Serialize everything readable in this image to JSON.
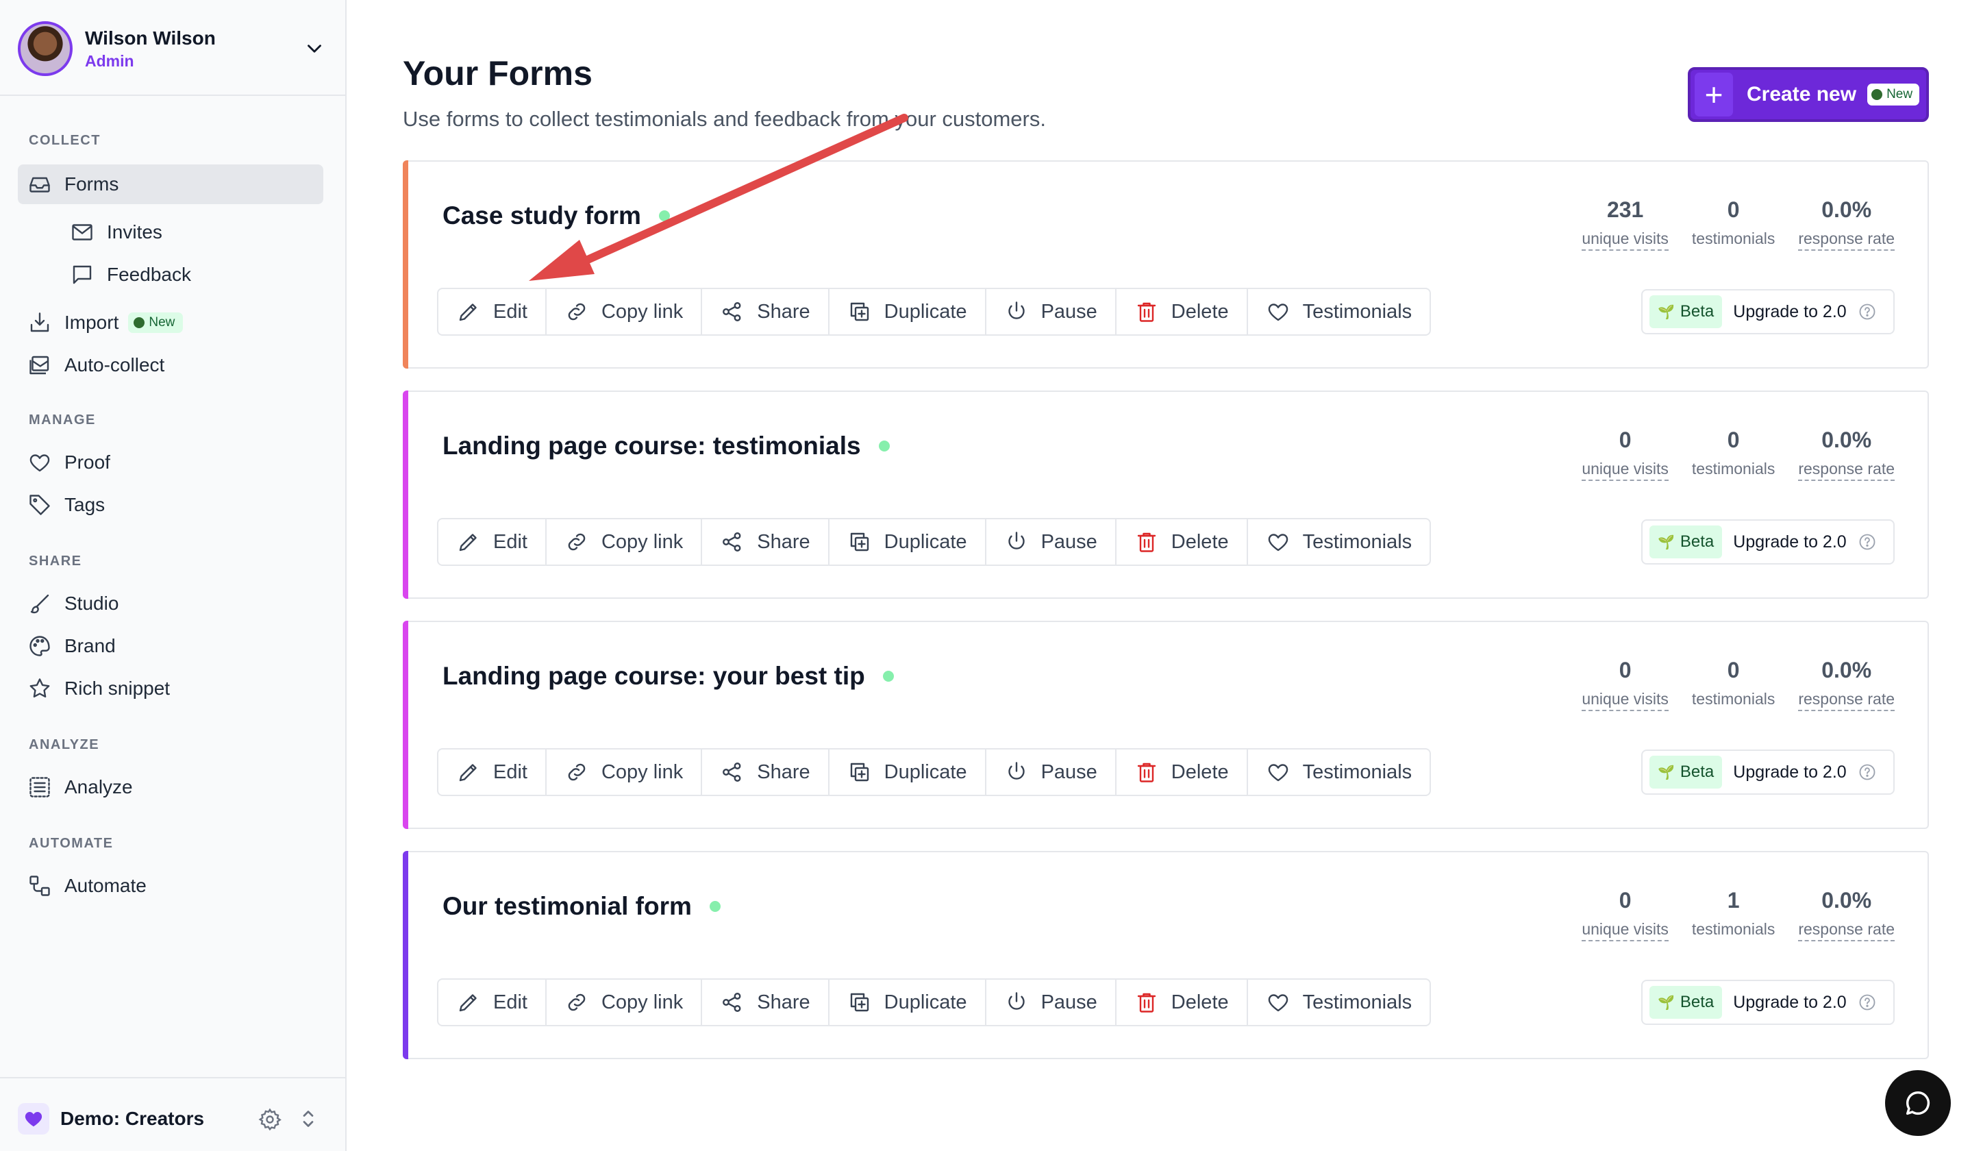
{
  "user": {
    "name": "Wilson Wilson",
    "role": "Admin"
  },
  "sidebar": {
    "sections": {
      "collect": "COLLECT",
      "manage": "MANAGE",
      "share": "SHARE",
      "analyze": "ANALYZE",
      "automate": "AUTOMATE"
    },
    "items": {
      "forms": "Forms",
      "invites": "Invites",
      "feedback": "Feedback",
      "import": "Import",
      "import_badge": "New",
      "autocollect": "Auto-collect",
      "proof": "Proof",
      "tags": "Tags",
      "studio": "Studio",
      "brand": "Brand",
      "rich_snippet": "Rich snippet",
      "analyze": "Analyze",
      "automate": "Automate"
    },
    "workspace": "Demo: Creators"
  },
  "header": {
    "title": "Your Forms",
    "subtitle": "Use forms to collect testimonials and feedback from your customers.",
    "create_label": "Create new",
    "create_badge": "New"
  },
  "actions": {
    "edit": "Edit",
    "copy_link": "Copy link",
    "share": "Share",
    "duplicate": "Duplicate",
    "pause": "Pause",
    "delete": "Delete",
    "testimonials": "Testimonials"
  },
  "stat_labels": {
    "visits": "unique visits",
    "testimonials": "testimonials",
    "rate": "response rate"
  },
  "beta": {
    "badge": "Beta",
    "upgrade": "Upgrade to 2.0"
  },
  "forms": [
    {
      "title": "Case study form",
      "visits": "231",
      "testimonials": "0",
      "rate": "0.0%",
      "accent": "#f0845a"
    },
    {
      "title": "Landing page course: testimonials",
      "visits": "0",
      "testimonials": "0",
      "rate": "0.0%",
      "accent": "#d946ef"
    },
    {
      "title": "Landing page course: your best tip",
      "visits": "0",
      "testimonials": "0",
      "rate": "0.0%",
      "accent": "#d946ef"
    },
    {
      "title": "Our testimonial form",
      "visits": "0",
      "testimonials": "1",
      "rate": "0.0%",
      "accent": "#7c3aed"
    }
  ],
  "colors": {
    "brand": "#6d28d9",
    "annotation_arrow": "#e04848",
    "status_dot": "#86efac",
    "delete": "#dc2626"
  }
}
